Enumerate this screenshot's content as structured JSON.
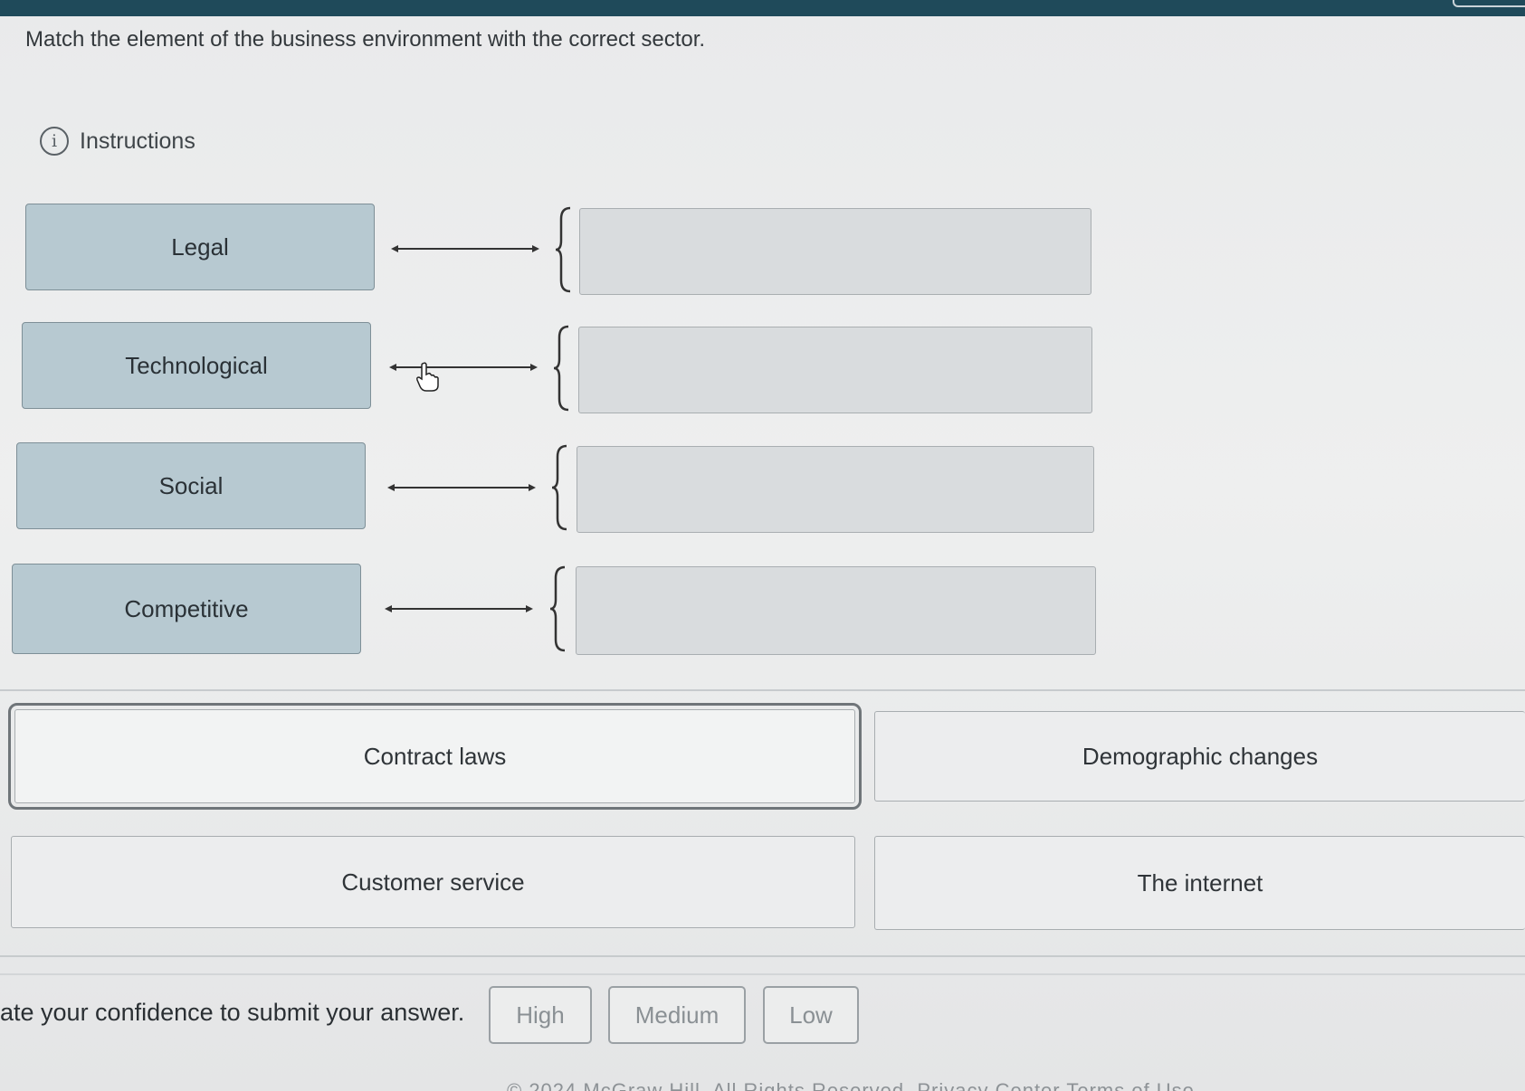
{
  "question": "Match the element of the business environment with the correct sector.",
  "instructions_label": "Instructions",
  "icons": {
    "info": "info-icon",
    "cursor": "hand-pointer-icon"
  },
  "sectors": [
    {
      "label": "Legal"
    },
    {
      "label": "Technological"
    },
    {
      "label": "Social"
    },
    {
      "label": "Competitive"
    }
  ],
  "options": [
    {
      "label": "Contract laws",
      "selected": true
    },
    {
      "label": "Demographic changes",
      "selected": false
    },
    {
      "label": "Customer service",
      "selected": false
    },
    {
      "label": "The internet",
      "selected": false
    }
  ],
  "confidence": {
    "prompt": "ate your confidence to submit your answer.",
    "buttons": [
      "High",
      "Medium",
      "Low"
    ]
  },
  "footer": "© 2024 McGraw Hill. All Rights Reserved. Privacy Center Terms of Use",
  "colors": {
    "header": "#1f4a5a",
    "sector_fill": "#b7c9d1",
    "dropzone_fill": "#d9dcde"
  }
}
